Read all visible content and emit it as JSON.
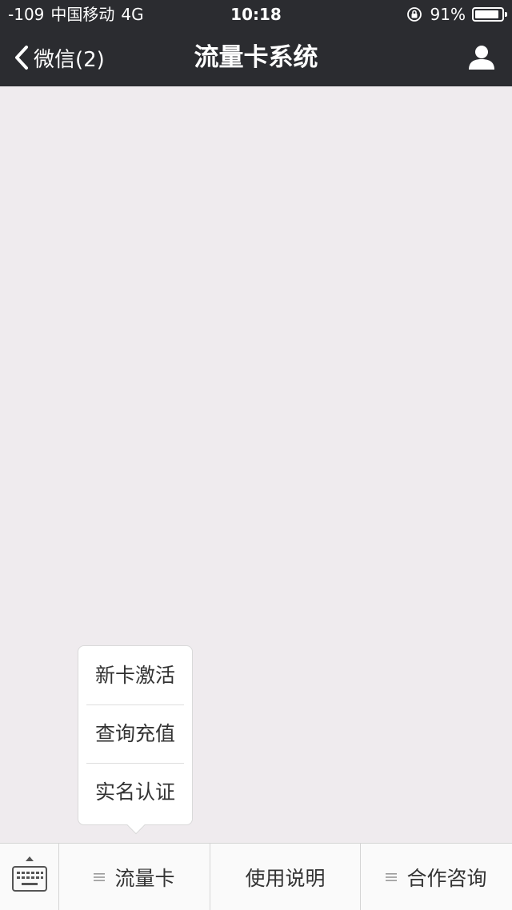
{
  "status_bar": {
    "signal": "-109",
    "carrier": "中国移动",
    "network": "4G",
    "time": "10:18",
    "battery_percent": "91%",
    "battery_level": 0.91
  },
  "nav": {
    "back_label": "微信(2)",
    "title": "流量卡系统",
    "profile_icon": "person-icon"
  },
  "popup_menu": {
    "items": [
      {
        "label": "新卡激活"
      },
      {
        "label": "查询充值"
      },
      {
        "label": "实名认证"
      }
    ]
  },
  "bottom_menu": {
    "keyboard_icon": "keyboard-icon",
    "items": [
      {
        "label": "流量卡",
        "has_submenu": true
      },
      {
        "label": "使用说明",
        "has_submenu": false
      },
      {
        "label": "合作咨询",
        "has_submenu": true
      }
    ]
  },
  "colors": {
    "nav_bg": "#2b2c30",
    "content_bg": "#efebee",
    "menu_bg": "#fafafa"
  }
}
